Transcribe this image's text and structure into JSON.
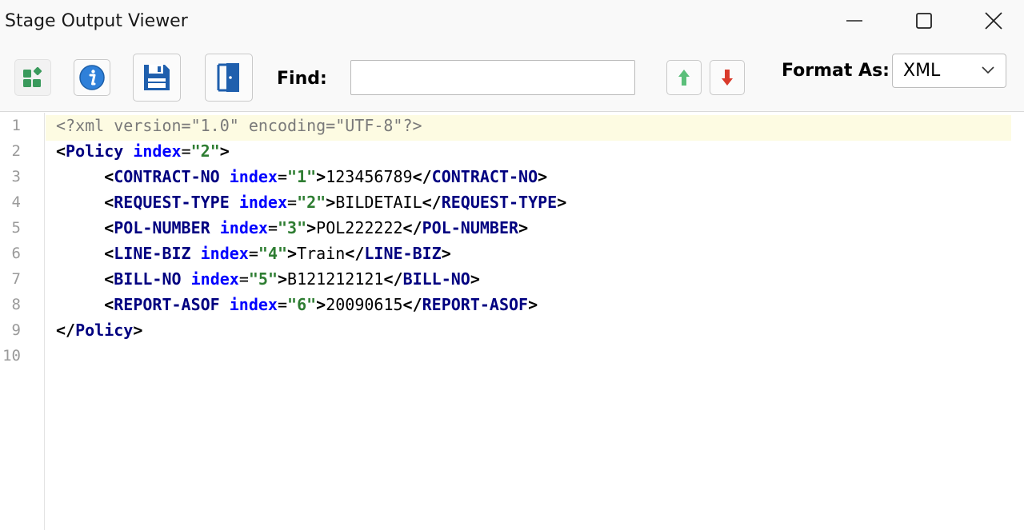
{
  "window": {
    "title": "Stage Output Viewer"
  },
  "toolbar": {
    "find_label": "Find:",
    "find_value": "",
    "format_label": "Format As:",
    "format_value": "XML"
  },
  "colors": {
    "tag": "#000080",
    "attribute": "#0000ff",
    "attribute_value": "#2e7d32",
    "declaration": "#7a7a7a",
    "current_line_highlight": "#fdfbe2",
    "info_icon": "#2f80d9",
    "save_icon": "#1f5fad",
    "up_arrow": "#5bbf7a",
    "down_arrow": "#d93a2b"
  },
  "editor": {
    "line_numbers": [
      "1",
      "2",
      "3",
      "4",
      "5",
      "6",
      "7",
      "8",
      "9",
      "10"
    ],
    "indent": "     ",
    "declaration": "<?xml version=\"1.0\" encoding=\"UTF-8\"?>",
    "root": {
      "open_lt": "<",
      "open_gt": ">",
      "close_lt": "</",
      "name": "Policy",
      "attr": "index",
      "eq": "=",
      "value": "\"2\""
    },
    "children": [
      {
        "name": "CONTRACT-NO",
        "attr": "index",
        "value": "\"1\"",
        "text": "123456789"
      },
      {
        "name": "REQUEST-TYPE",
        "attr": "index",
        "value": "\"2\"",
        "text": "BILDETAIL"
      },
      {
        "name": "POL-NUMBER",
        "attr": "index",
        "value": "\"3\"",
        "text": "POL222222"
      },
      {
        "name": "LINE-BIZ",
        "attr": "index",
        "value": "\"4\"",
        "text": "Train"
      },
      {
        "name": "BILL-NO",
        "attr": "index",
        "value": "\"5\"",
        "text": "B121212121"
      },
      {
        "name": "REPORT-ASOF",
        "attr": "index",
        "value": "\"6\"",
        "text": "20090615"
      }
    ]
  }
}
